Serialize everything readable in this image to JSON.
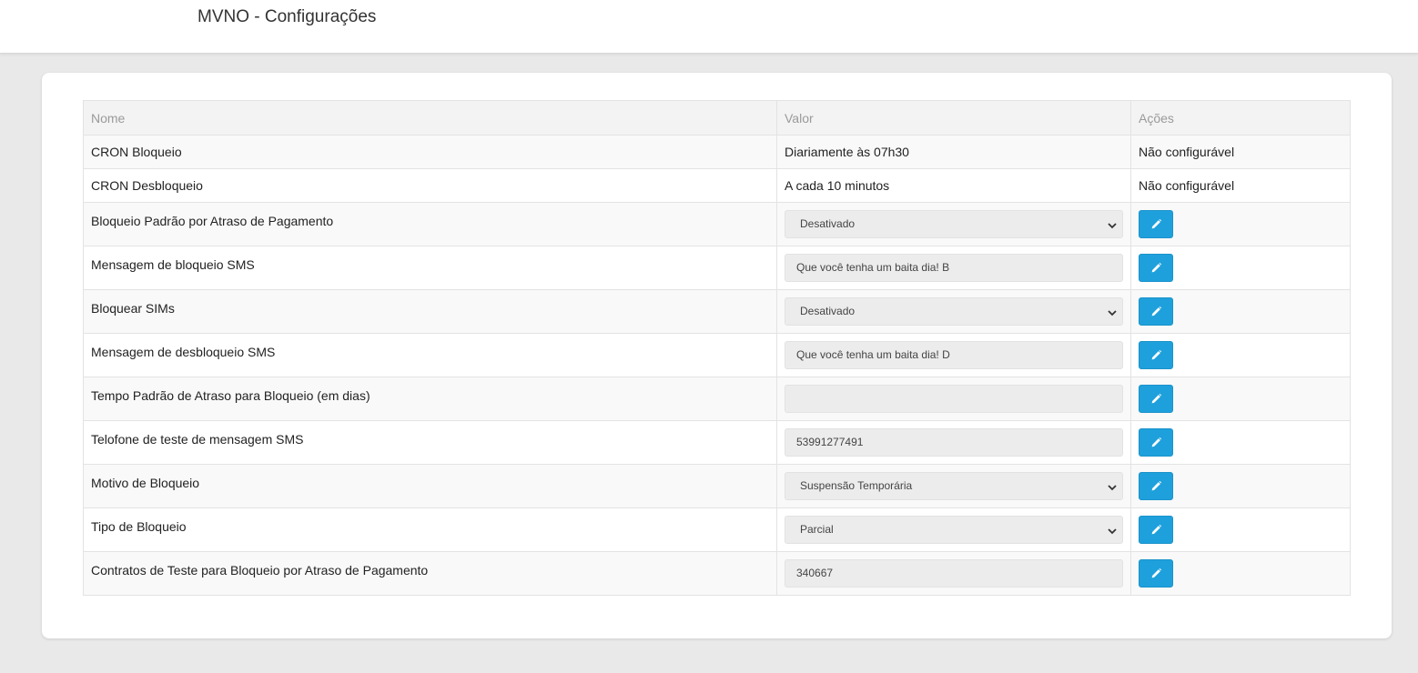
{
  "header": {
    "title": "MVNO - Configurações"
  },
  "table": {
    "columns": {
      "nome": "Nome",
      "valor": "Valor",
      "acoes": "Ações"
    },
    "text_rows": [
      {
        "nome": "CRON Bloqueio",
        "valor": "Diariamente às 07h30",
        "acoes": "Não configurável"
      },
      {
        "nome": "CRON Desbloqueio",
        "valor": "A cada 10 minutos",
        "acoes": "Não configurável"
      }
    ],
    "control_rows": [
      {
        "nome": "Bloqueio Padrão por Atraso de Pagamento",
        "type": "select",
        "value": "Desativado"
      },
      {
        "nome": "Mensagem de bloqueio SMS",
        "type": "input",
        "value": "Que você tenha um baita dia! B"
      },
      {
        "nome": "Bloquear SIMs",
        "type": "select",
        "value": "Desativado"
      },
      {
        "nome": "Mensagem de desbloqueio SMS",
        "type": "input",
        "value": "Que você tenha um baita dia! D"
      },
      {
        "nome": "Tempo Padrão de Atraso para Bloqueio (em dias)",
        "type": "input",
        "value": ""
      },
      {
        "nome": "Telofone de teste de mensagem SMS",
        "type": "input",
        "value": "53991277491"
      },
      {
        "nome": "Motivo de Bloqueio",
        "type": "select",
        "value": "Suspensão Temporária"
      },
      {
        "nome": "Tipo de Bloqueio",
        "type": "select",
        "value": "Parcial"
      },
      {
        "nome": "Contratos de Teste para Bloqueio por Atraso de Pagamento",
        "type": "input",
        "value": "340667"
      }
    ],
    "edit_icon": "pencil-icon"
  },
  "colors": {
    "accent": "#1ea0dc",
    "background": "#e9e9e9"
  }
}
